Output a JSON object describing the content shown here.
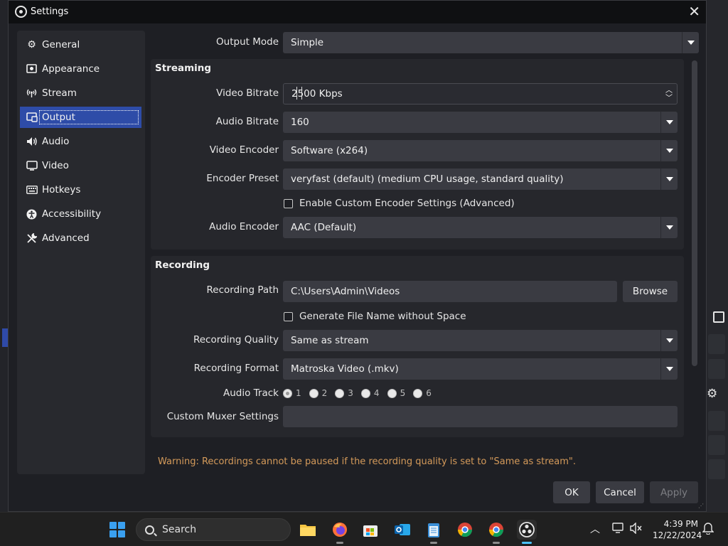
{
  "window": {
    "title": "Settings"
  },
  "sidebar": {
    "items": [
      {
        "label": "General",
        "icon": "gear-icon"
      },
      {
        "label": "Appearance",
        "icon": "appearance-icon"
      },
      {
        "label": "Stream",
        "icon": "antenna-icon"
      },
      {
        "label": "Output",
        "icon": "output-icon",
        "active": true
      },
      {
        "label": "Audio",
        "icon": "speaker-icon"
      },
      {
        "label": "Video",
        "icon": "monitor-icon"
      },
      {
        "label": "Hotkeys",
        "icon": "keyboard-icon"
      },
      {
        "label": "Accessibility",
        "icon": "accessibility-icon"
      },
      {
        "label": "Advanced",
        "icon": "tools-icon"
      }
    ]
  },
  "output_mode": {
    "label": "Output Mode",
    "value": "Simple"
  },
  "streaming": {
    "title": "Streaming",
    "video_bitrate": {
      "label": "Video Bitrate",
      "value": "2500 Kbps"
    },
    "audio_bitrate": {
      "label": "Audio Bitrate",
      "value": "160"
    },
    "video_encoder": {
      "label": "Video Encoder",
      "value": "Software (x264)"
    },
    "encoder_preset": {
      "label": "Encoder Preset",
      "value": "veryfast (default) (medium CPU usage, standard quality)"
    },
    "custom_encoder": {
      "label": "Enable Custom Encoder Settings (Advanced)",
      "checked": false
    },
    "audio_encoder": {
      "label": "Audio Encoder",
      "value": "AAC (Default)"
    }
  },
  "recording": {
    "title": "Recording",
    "path": {
      "label": "Recording Path",
      "value": "C:\\Users\\Admin\\Videos",
      "browse": "Browse"
    },
    "no_space": {
      "label": "Generate File Name without Space",
      "checked": false
    },
    "quality": {
      "label": "Recording Quality",
      "value": "Same as stream"
    },
    "format": {
      "label": "Recording Format",
      "value": "Matroska Video (.mkv)"
    },
    "audio_track": {
      "label": "Audio Track",
      "tracks": [
        "1",
        "2",
        "3",
        "4",
        "5",
        "6"
      ],
      "selected": "1"
    },
    "muxer": {
      "label": "Custom Muxer Settings",
      "value": ""
    }
  },
  "warning": "Warning: Recordings cannot be paused if the recording quality is set to \"Same as stream\".",
  "buttons": {
    "ok": "OK",
    "cancel": "Cancel",
    "apply": "Apply"
  },
  "taskbar": {
    "search_placeholder": "Search",
    "time": "4:39 PM",
    "date": "12/22/2024"
  },
  "colors": {
    "accent": "#2e4ca8",
    "warning": "#d49a5a",
    "field_bg": "#3a3b42"
  }
}
